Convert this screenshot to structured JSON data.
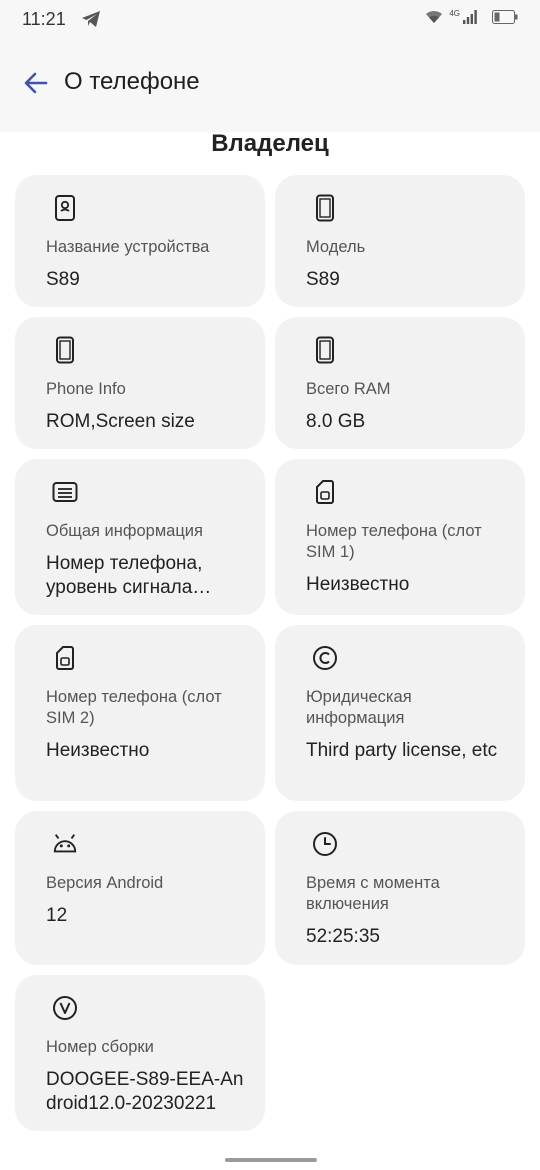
{
  "status_bar": {
    "time": "11:21",
    "network": "4G",
    "icons": [
      "telegram-icon",
      "wifi-icon",
      "signal-icon",
      "battery-icon"
    ]
  },
  "header": {
    "back_icon": "arrow-back-icon",
    "title": "О телефоне"
  },
  "section": {
    "owner_heading": "Владелец"
  },
  "cards": [
    {
      "icon": "device-name-icon",
      "label": "Название устройства",
      "value": "S89"
    },
    {
      "icon": "phone-icon",
      "label": "Модель",
      "value": "S89"
    },
    {
      "icon": "phone-icon",
      "label": "Phone Info",
      "value": "ROM,Screen size"
    },
    {
      "icon": "phone-icon",
      "label": "Всего RAM",
      "value": "8.0 GB"
    },
    {
      "icon": "info-list-icon",
      "label": "Общая информация",
      "value": "Номер телефона, уровень сигнала…"
    },
    {
      "icon": "sim-icon",
      "label": "Номер телефона (слот SIM 1)",
      "value": "Неизвестно"
    },
    {
      "icon": "sim-icon",
      "label": "Номер телефона (слот SIM 2)",
      "value": "Неизвестно"
    },
    {
      "icon": "copyright-icon",
      "label": "Юридическая информация",
      "value": "Third party license, etc"
    },
    {
      "icon": "android-icon",
      "label": "Версия Android",
      "value": "12"
    },
    {
      "icon": "clock-icon",
      "label": "Время с момента включения",
      "value": "52:25:35"
    },
    {
      "icon": "version-icon",
      "label": "Номер сборки",
      "value": "DOOGEE-S89-EEA-Android12.0-20230221"
    }
  ],
  "colors": {
    "accent": "#3f51b5",
    "card_background": "#f2f2f2",
    "app_bar_background": "#f7f7f7"
  }
}
